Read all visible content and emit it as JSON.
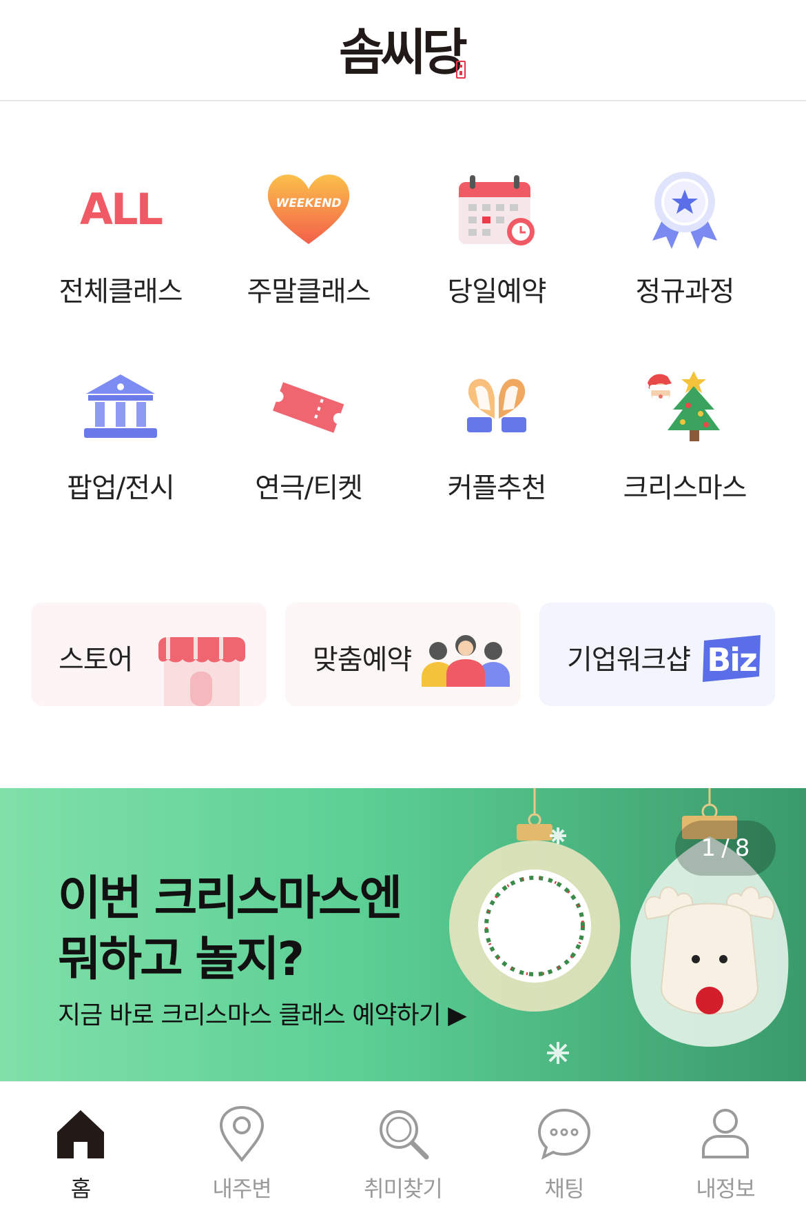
{
  "header": {
    "logo_text": "솜씨당",
    "logo_icon": "brand-seal"
  },
  "categories": [
    {
      "label": "전체클래스",
      "icon": "all-badge",
      "badge_text": "ALL"
    },
    {
      "label": "주말클래스",
      "icon": "weekend-heart",
      "badge_text": "WEEKEND"
    },
    {
      "label": "당일예약",
      "icon": "calendar-clock"
    },
    {
      "label": "정규과정",
      "icon": "award-ribbon"
    },
    {
      "label": "팝업/전시",
      "icon": "museum"
    },
    {
      "label": "연극/티켓",
      "icon": "ticket"
    },
    {
      "label": "커플추천",
      "icon": "heart-hands"
    },
    {
      "label": "크리스마스",
      "icon": "santa-tree"
    }
  ],
  "shortcuts": [
    {
      "label": "스토어",
      "icon": "store-awning"
    },
    {
      "label": "맞춤예약",
      "icon": "people-group"
    },
    {
      "label": "기업워크샵",
      "icon": "biz-badge",
      "badge_text": "Biz"
    }
  ],
  "banner": {
    "title_line1": "이번 크리스마스엔",
    "title_line2": "뭐하고 놀지?",
    "subtitle": "지금 바로 크리스마스 클래스 예약하기 ▶",
    "pager_current": "1",
    "pager_separator": "/",
    "pager_total": "8",
    "background_color": "#5ccf95"
  },
  "bottom_nav": [
    {
      "label": "홈",
      "icon": "home-icon",
      "active": true
    },
    {
      "label": "내주변",
      "icon": "location-pin-icon",
      "active": false
    },
    {
      "label": "취미찾기",
      "icon": "search-icon",
      "active": false
    },
    {
      "label": "채팅",
      "icon": "chat-bubble-icon",
      "active": false
    },
    {
      "label": "내정보",
      "icon": "user-icon",
      "active": false
    }
  ],
  "colors": {
    "brand_dark": "#221a18",
    "accent_red": "#e2374a",
    "nav_inactive": "#9a9a9a"
  }
}
